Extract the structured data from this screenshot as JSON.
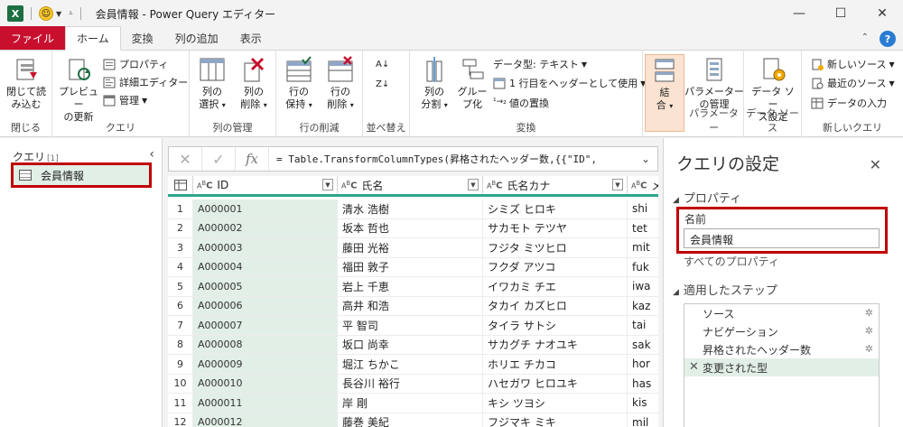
{
  "window": {
    "title": "会員情報 - Power Query エディター",
    "app_icon": "X",
    "controls": [
      "minimize-icon",
      "maximize-icon",
      "close-icon"
    ]
  },
  "tabs": [
    {
      "label": "ファイル",
      "kind": "file"
    },
    {
      "label": "ホーム",
      "kind": "active"
    },
    {
      "label": "変換",
      "kind": ""
    },
    {
      "label": "列の追加",
      "kind": ""
    },
    {
      "label": "表示",
      "kind": ""
    }
  ],
  "ribbon": {
    "close": {
      "btn": "閉じて読\nみ込む",
      "label": "閉じる"
    },
    "query": {
      "preview": "プレビュー\nの更新",
      "props": "プロパティ",
      "adv": "詳細エディター",
      "manage": "管理",
      "label": "クエリ"
    },
    "cols": {
      "select": "列の\n選択",
      "remove": "列の\n削除",
      "label": "列の管理"
    },
    "rows": {
      "keep": "行の\n保持",
      "remove": "行の\n削除",
      "label": "行の削減"
    },
    "sort": {
      "label": "並べ替え"
    },
    "transform": {
      "split": "列の\n分割",
      "group": "グルー\nプ化",
      "dtype": "データ型: テキスト",
      "header": "1 行目をヘッダーとして使用",
      "replace": "値の置換",
      "label": "変換"
    },
    "combine": {
      "btn": "結\n合"
    },
    "params": {
      "btn": "パラメーター\nの管理",
      "label": "パラメーター"
    },
    "datasrc": {
      "btn": "データ ソー\nス設定",
      "label": "データ ソース"
    },
    "newq": {
      "new": "新しいソース",
      "recent": "最近のソース",
      "enter": "データの入力",
      "label": "新しいクエリ"
    }
  },
  "queries_pane": {
    "title": "クエリ",
    "count": "[1]",
    "items": [
      "会員情報"
    ]
  },
  "formula": "= Table.TransformColumnTypes(昇格されたヘッダー数,{{\"ID\",",
  "columns": [
    {
      "type": "ABC",
      "name": "ID"
    },
    {
      "type": "ABC",
      "name": "氏名"
    },
    {
      "type": "ABC",
      "name": "氏名カナ"
    },
    {
      "type": "ABC",
      "name": "メ"
    }
  ],
  "rows": [
    {
      "n": "1",
      "id": "A000001",
      "name": "清水 浩樹",
      "kana": "シミズ ヒロキ",
      "m": "shi"
    },
    {
      "n": "2",
      "id": "A000002",
      "name": "坂本 哲也",
      "kana": "サカモト テツヤ",
      "m": "tet"
    },
    {
      "n": "3",
      "id": "A000003",
      "name": "藤田 光裕",
      "kana": "フジタ ミツヒロ",
      "m": "mit"
    },
    {
      "n": "4",
      "id": "A000004",
      "name": "福田 敦子",
      "kana": "フクダ アツコ",
      "m": "fuk"
    },
    {
      "n": "5",
      "id": "A000005",
      "name": "岩上 千恵",
      "kana": "イワカミ チエ",
      "m": "iwa"
    },
    {
      "n": "6",
      "id": "A000006",
      "name": "高井 和浩",
      "kana": "タカイ カズヒロ",
      "m": "kaz"
    },
    {
      "n": "7",
      "id": "A000007",
      "name": "平 智司",
      "kana": "タイラ サトシ",
      "m": "tai"
    },
    {
      "n": "8",
      "id": "A000008",
      "name": "坂口 尚幸",
      "kana": "サカグチ ナオユキ",
      "m": "sak"
    },
    {
      "n": "9",
      "id": "A000009",
      "name": "堀江 ちかこ",
      "kana": "ホリエ チカコ",
      "m": "hor"
    },
    {
      "n": "10",
      "id": "A000010",
      "name": "長谷川 裕行",
      "kana": "ハセガワ ヒロユキ",
      "m": "has"
    },
    {
      "n": "11",
      "id": "A000011",
      "name": "岸 剛",
      "kana": "キシ ツヨシ",
      "m": "kis"
    },
    {
      "n": "12",
      "id": "A000012",
      "name": "藤巻 美紀",
      "kana": "フジマキ ミキ",
      "m": "mil"
    }
  ],
  "settings": {
    "title": "クエリの設定",
    "properties": "プロパティ",
    "name_label": "名前",
    "name_value": "会員情報",
    "all_props": "すべてのプロパティ",
    "steps_title": "適用したステップ",
    "steps": [
      {
        "label": "ソース",
        "gear": true,
        "selected": false
      },
      {
        "label": "ナビゲーション",
        "gear": true,
        "selected": false
      },
      {
        "label": "昇格されたヘッダー数",
        "gear": true,
        "selected": false
      },
      {
        "label": "変更された型",
        "gear": false,
        "selected": true
      }
    ]
  }
}
